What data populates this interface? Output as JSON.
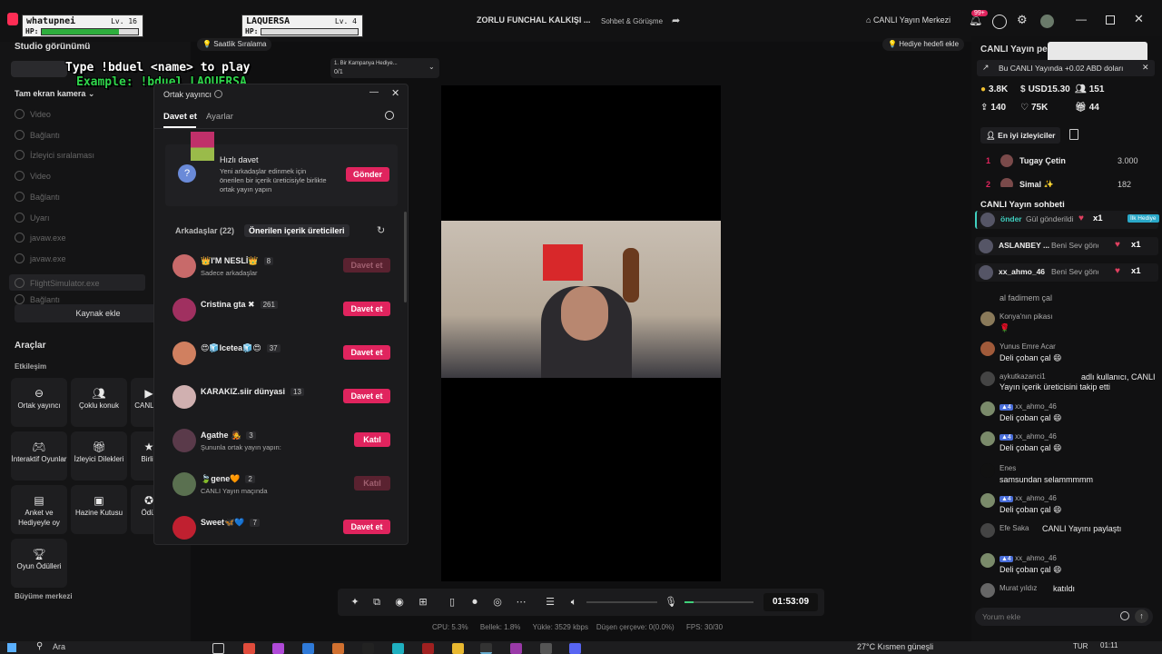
{
  "window": {
    "title": "ZORLU FUNCHAL KALKIŞI ...",
    "subtitle": "Sohbet & Görüşme",
    "live_center": "CANLI Yayın Merkezi",
    "notif_badge": "99+"
  },
  "game": {
    "p1": {
      "name": "whatupnei",
      "level": "Lv. 16",
      "hp_label": "HP:",
      "hp_fill": 0.8,
      "hp_color": "#2eae3d"
    },
    "p2": {
      "name": "LAQUERSA",
      "level": "Lv. 4",
      "hp_label": "HP:",
      "hp_fill": 0.0,
      "hp_color": "#2eae3d"
    },
    "instruction": "Type !bduel <name> to play",
    "example": "Example: !bduel LAQUERSA"
  },
  "left": {
    "studio_view": "Studio görünümü",
    "hourly_rank": "Saatlik Sıralama",
    "camera_label": "Tam ekran kamera",
    "sources": [
      "Video",
      "Bağlantı",
      "İzleyici sıralaması",
      "Video",
      "Bağlantı",
      "Uyarı",
      "javaw.exe",
      "javaw.exe",
      "FlightSimulator.exe",
      "Bağlantı"
    ],
    "add_source": "Kaynak ekle",
    "tools_title": "Araçlar",
    "interaction": "Etkileşim",
    "tools": [
      {
        "label": "Ortak yayıncı",
        "icon": "link-icon"
      },
      {
        "label": "Çoklu konuk",
        "icon": "users-icon"
      },
      {
        "label": "CANLI H",
        "icon": "live-icon"
      },
      {
        "label": "İnteraktif Oyunlar",
        "icon": "gamepad-icon"
      },
      {
        "label": "İzleyici Dilekleri",
        "icon": "gift-icon"
      },
      {
        "label": "Birlik",
        "icon": "star-icon"
      },
      {
        "label": "Anket ve Hediyeyle oy",
        "icon": "poll-icon"
      },
      {
        "label": "Hazine Kutusu",
        "icon": "chest-icon"
      },
      {
        "label": "Ödül",
        "icon": "award-icon"
      },
      {
        "label": "Oyun Ödülleri",
        "icon": "trophy-icon"
      }
    ],
    "growth": "Büyüme merkezi"
  },
  "campaign": {
    "label": "1. Bir Kampanya Hediye...",
    "count": "0/1"
  },
  "dialog": {
    "title": "Ortak yayıncı",
    "tabs": [
      "Davet et",
      "Ayarlar"
    ],
    "quick_title": "Hızlı davet",
    "quick_desc": "Yeni arkadaşlar edinmek için önerilen bir içerik üreticisiyle birlikte ortak yayın yapın",
    "quick_btn": "Gönder",
    "friends_label": "Arkadaşlar (22)",
    "suggested_label": "Önerilen içerik üreticileri",
    "friends": [
      {
        "name": "👑I'M NESLİ👑",
        "count": "8",
        "sub": "Sadece arkadaşlar",
        "btn": "Davet et",
        "disabled": true,
        "color": "#c86a6a"
      },
      {
        "name": "Cristina gta ✖",
        "count": "261",
        "sub": "",
        "btn": "Davet et",
        "disabled": false,
        "color": "#a03060"
      },
      {
        "name": "😍🧊Icetea🧊😍",
        "count": "37",
        "sub": "",
        "btn": "Davet et",
        "disabled": false,
        "color": "#d08060"
      },
      {
        "name": "KARAKIZ.siir dünyasi",
        "count": "13",
        "sub": "",
        "btn": "Davet et",
        "disabled": false,
        "color": "#d0b0b0"
      },
      {
        "name": "Agathe 🧑‍🎤",
        "count": "3",
        "sub": "Şununla ortak yayın yapın:",
        "btn": "Katıl",
        "disabled": false,
        "color": "#5a3a4a"
      },
      {
        "name": "🍃gene🧡",
        "count": "2",
        "sub": "CANLI Yayın maçında",
        "btn": "Katıl",
        "disabled": true,
        "color": "#5a7050"
      },
      {
        "name": "Sweet🦋💙",
        "count": "7",
        "sub": "",
        "btn": "Davet et",
        "disabled": false,
        "color": "#c02030"
      }
    ]
  },
  "controls": {
    "timer": "01:53:09"
  },
  "stats": {
    "cpu": "CPU: 5.3%",
    "mem": "Bellek: 1.8%",
    "upload": "Yükle: 3529 kbps",
    "drop": "Düşen çerçeve: 0(0.0%)",
    "fps": "FPS: 30/30"
  },
  "right": {
    "goal": "Hediye hedefi ekle",
    "live_perf": "CANLI Yayın pe",
    "banner": "Bu CANLI Yayında +0.02 ABD doları",
    "metrics": [
      {
        "icon": "coin-icon",
        "value": "3.8K"
      },
      {
        "icon": "dollar-icon",
        "value": "USD15.30"
      },
      {
        "icon": "viewers-icon",
        "value": "151"
      },
      {
        "icon": "follow-icon",
        "value": "140"
      },
      {
        "icon": "heart-icon",
        "value": "75K"
      },
      {
        "icon": "gift-icon",
        "value": "44"
      }
    ],
    "top_viewers": "En iyi izleyiciler",
    "ranking": [
      {
        "rank": "1",
        "name": "Tugay Çetin",
        "score": "3.000"
      },
      {
        "rank": "2",
        "name": "Simal ✨",
        "score": "182"
      }
    ],
    "chat_title": "CANLI Yayın sohbeti",
    "gifts": [
      {
        "user": "önder",
        "text": "Gül gönderildi",
        "mult": "x1",
        "tag": "İlk Hediye"
      },
      {
        "user": "ASLANBEY ...",
        "text": "Beni Sev gönderildi",
        "mult": "x1",
        "tag": ""
      },
      {
        "user": "xx_ahmo_46",
        "text": "Beni Sev gönderildi",
        "mult": "x1",
        "tag": ""
      }
    ],
    "chat": [
      {
        "user": "",
        "msg": "al fadimem çal"
      },
      {
        "user": "Konya'nın pikası",
        "msg": "🌹"
      },
      {
        "user": "Yunus Emre Acar",
        "msg": "Deli çoban çal 😄"
      },
      {
        "user": "aykutkazanci1",
        "msg": "adlı kullanıcı, CANLI Yayın içerik üreticisini takip etti"
      },
      {
        "user": "xx_ahmo_46",
        "msg": "Deli çoban çal 😄"
      },
      {
        "user": "xx_ahmo_46",
        "msg": "Deli çoban çal 😄"
      },
      {
        "user": "Enes",
        "msg": "samsundan selammmmm"
      },
      {
        "user": "xx_ahmo_46",
        "msg": "Deli çoban çal 😄"
      },
      {
        "user": "Efe Saka",
        "msg": "CANLI Yayını paylaştı"
      },
      {
        "user": "xx_ahmo_46",
        "msg": "Deli çoban çal 😄"
      },
      {
        "user": "Murat yıldız",
        "msg": "katıldı"
      }
    ],
    "chat_placeholder": "Yorum ekle"
  },
  "taskbar": {
    "search": "Ara",
    "weather": "27°C  Kısmen güneşli",
    "lang": "TUR",
    "time": "01:11"
  }
}
